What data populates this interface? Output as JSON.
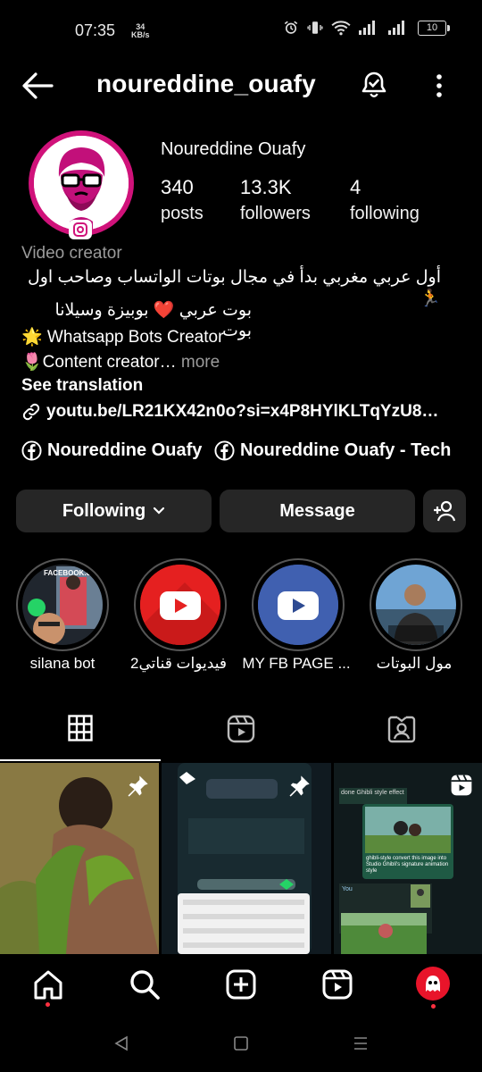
{
  "status": {
    "time": "07:35",
    "net_speed": "34",
    "net_unit": "KB/s",
    "battery": "10"
  },
  "header": {
    "username": "noureddine_ouafy"
  },
  "profile": {
    "display_name": "Noureddine Ouafy",
    "posts_count": "340",
    "posts_label": "posts",
    "followers_count": "13.3K",
    "followers_label": "followers",
    "following_count": "4",
    "following_label": "following",
    "category": "Video creator",
    "bio_line1": "أول عربي مغربي بدأ في مجال بوتات الواتساب وصاحب اول 🏃",
    "bio_line2": "بوت عربي ❤️ بوبيزة وسيلانا بوت",
    "bio_line3": "🌟 Whatsapp Bots Creator",
    "bio_line4": "🌷Content creator…",
    "bio_more": "more",
    "see_translation": "See translation",
    "link": "youtu.be/LR21KX42n0o?si=x4P8HYlKLTqYzU8…",
    "fb_link_1": "Noureddine Ouafy",
    "fb_link_2": "Noureddine Ouafy - Tech"
  },
  "actions": {
    "following": "Following",
    "message": "Message"
  },
  "highlights": [
    {
      "label": "silana bot",
      "thumb_text": "FACEBOOK.COM"
    },
    {
      "label": "فيديوات قناتي2"
    },
    {
      "label": "MY FB PAGE ..."
    },
    {
      "label": "مول البوتات"
    }
  ],
  "grid": {
    "cell3_header": "done Ghibli style effect",
    "cell3_caption": "ghibli-style convert this image into Studio Ghibli's signature animation style",
    "cell3_reply_name": "You"
  },
  "colors": {
    "accent_ring": "#d0127a",
    "button_bg": "#262626",
    "notify_dot": "#ff3040"
  }
}
